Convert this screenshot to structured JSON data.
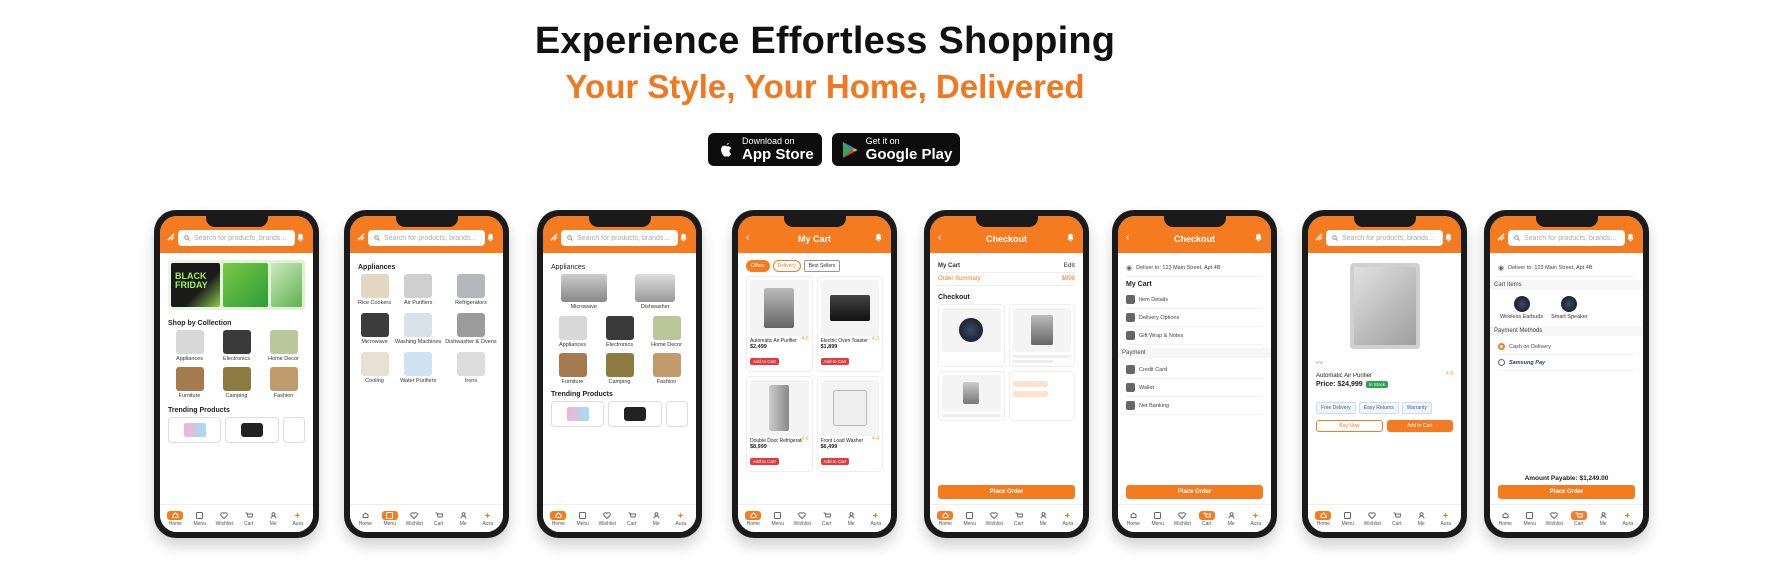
{
  "hero": {
    "title": "Experience Effortless Shopping",
    "subtitle": "Your Style, Your Home, Delivered"
  },
  "store_badges": [
    {
      "small": "Download on",
      "big": "App Store",
      "icon": "apple-icon"
    },
    {
      "small": "Get it on",
      "big": "Google Play",
      "icon": "google-play-icon"
    }
  ],
  "colors": {
    "brand": "#f47b20",
    "title": "#111111",
    "frame": "#1a1a1a"
  },
  "nav": [
    "Home",
    "Menu",
    "Wishlist",
    "Cart",
    "Me",
    "Aura"
  ],
  "phone1": {
    "search_placeholder": "Search for products, brands...",
    "banner_text": "BLACK FRIDAY",
    "shop_by": "Shop by Collection",
    "categories": [
      "Appliances",
      "Electronics",
      "Home Decor",
      "Furniture",
      "Camping",
      "Fashion"
    ],
    "trending": "Trending Products"
  },
  "phone2": {
    "search_placeholder": "Search for products, brands...",
    "section": "Appliances",
    "items": [
      "Rice Cookers",
      "Air Purifiers",
      "Refrigerators",
      "Microwave",
      "Washing Machines",
      "Dishwasher & Ovens",
      "Cooling",
      "Water Purifiers",
      "Irons"
    ]
  },
  "phone3": {
    "section": "Appliances",
    "items": [
      "Microwave",
      "Dishwasher"
    ],
    "categories": [
      "Appliances",
      "Electronics",
      "Home Decor",
      "Furniture",
      "Camping",
      "Fashion"
    ],
    "trending": "Trending Products"
  },
  "phone4": {
    "title": "My Cart",
    "chip1": "Offers",
    "chip2": "Delivery",
    "chip3": "Best Sellers",
    "products": [
      {
        "name": "Automatic Air Purifier",
        "price": "$2,499",
        "rating": "4.5",
        "pill": "Add to Cart"
      },
      {
        "name": "Electric Oven Toaster",
        "price": "$1,899",
        "rating": "4.3",
        "pill": "Add to Cart"
      },
      {
        "name": "Double Door Refrigerator",
        "price": "$8,999",
        "rating": "4.6",
        "pill": "Add to Cart"
      },
      {
        "name": "Front Load Washer",
        "price": "$6,499",
        "rating": "4.4",
        "pill": "Add to Cart"
      }
    ]
  },
  "phone5": {
    "title": "Checkout",
    "my_cart": "My Cart",
    "cart_right": "Edit",
    "cart_sub": "Order Summary",
    "cart_sub_val": "$998",
    "checkout": "Checkout",
    "cta": "Place Order"
  },
  "phone6": {
    "title": "Checkout",
    "address": "Deliver to: 123 Main Street, Apt 4B",
    "section1": "My Cart",
    "items1": [
      "Item Details",
      "Delivery Options",
      "Gift Wrap & Notes"
    ],
    "section2": "Payment",
    "items2": [
      "Credit Card",
      "Wallet",
      "Net Banking"
    ],
    "cta": "Place Order"
  },
  "phone7": {
    "search_placeholder": "Search for products, brands...",
    "rating": "4.8",
    "product": "Automatic Air Purifier",
    "price": "Price: $24,999",
    "tag": "In Stock",
    "chips": [
      "Free Delivery",
      "Easy Returns",
      "Warranty"
    ],
    "cta1": "Buy Now",
    "cta2": "Add to Cart"
  },
  "phone8": {
    "search_placeholder": "Search for products, brands...",
    "address": "Deliver to: 123 Main Street, Apt 4B",
    "section1": "Cart Items",
    "items": [
      "Wireless Earbuds",
      "Smart Speaker"
    ],
    "section2": "Payment Methods",
    "pay1": "Cash on Delivery",
    "pay2": "Samsung Pay",
    "total": "Amount Payable: $1,249.00",
    "cta": "Place Order"
  }
}
